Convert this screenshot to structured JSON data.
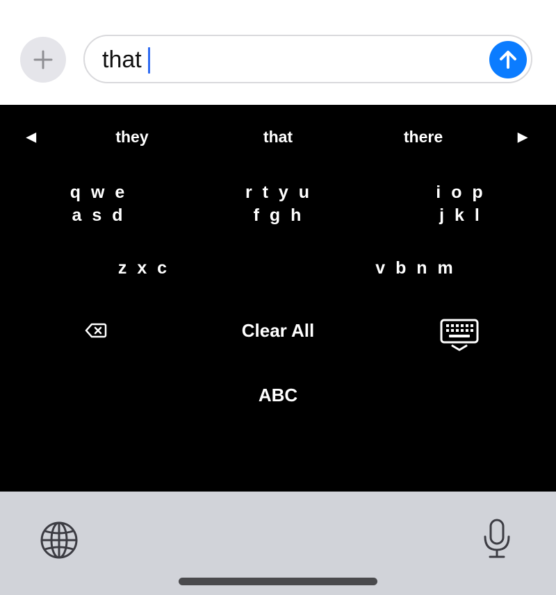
{
  "composer": {
    "text": "that",
    "add_icon": "plus-icon",
    "send_icon": "arrow-up-icon",
    "colors": {
      "send": "#0b7cff",
      "caret": "#2f6bf2",
      "add_bg": "#e5e5ea"
    }
  },
  "suggestions": {
    "prev_arrow": "◀",
    "next_arrow": "▶",
    "items": [
      "they",
      "that",
      "there"
    ]
  },
  "key_groups": {
    "row1": [
      "q w e\na s d",
      "r t y u\nf g h",
      "i o p\nj k l"
    ],
    "row2": [
      "z x c",
      "v b n m"
    ]
  },
  "actions": {
    "delete_icon": "delete-backward-icon",
    "clear_all": "Clear All",
    "hide_keyboard_icon": "keyboard-dismiss-icon",
    "abc": "ABC"
  },
  "bottom_bar": {
    "globe_icon": "globe-icon",
    "mic_icon": "microphone-icon"
  }
}
